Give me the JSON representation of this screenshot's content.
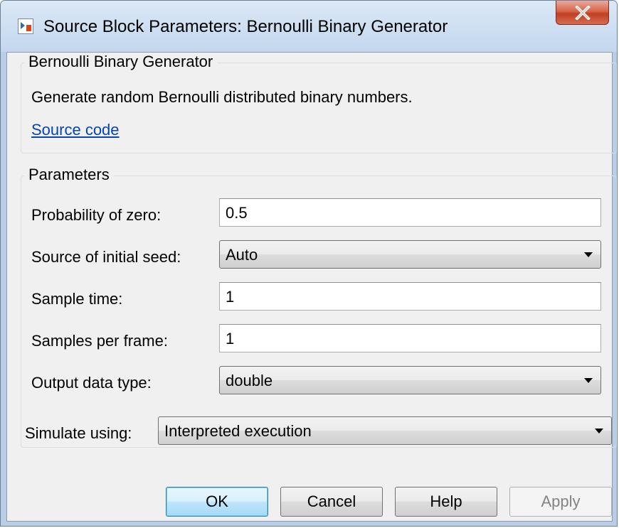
{
  "window": {
    "title": "Source Block Parameters: Bernoulli Binary Generator",
    "close_icon": "close-x-icon",
    "app_icon": "simulink-block-icon"
  },
  "description_group": {
    "label": "Bernoulli Binary Generator",
    "text": "Generate random Bernoulli distributed binary numbers.",
    "link": "Source code"
  },
  "parameters_group": {
    "label": "Parameters",
    "probability_of_zero": {
      "label": "Probability of zero:",
      "value": "0.5"
    },
    "source_of_initial_seed": {
      "label": "Source of initial seed:",
      "value": "Auto"
    },
    "sample_time": {
      "label": "Sample time:",
      "value": "1"
    },
    "samples_per_frame": {
      "label": "Samples per frame:",
      "value": "1"
    },
    "output_data_type": {
      "label": "Output data type:",
      "value": "double"
    }
  },
  "simulate": {
    "label": "Simulate using:",
    "value": "Interpreted execution"
  },
  "buttons": {
    "ok": "OK",
    "cancel": "Cancel",
    "help": "Help",
    "apply": "Apply"
  },
  "colors": {
    "link": "#0645ad",
    "close_button": "#c13f23",
    "default_button_border": "#3c7fb1",
    "disabled_text": "#838383"
  }
}
